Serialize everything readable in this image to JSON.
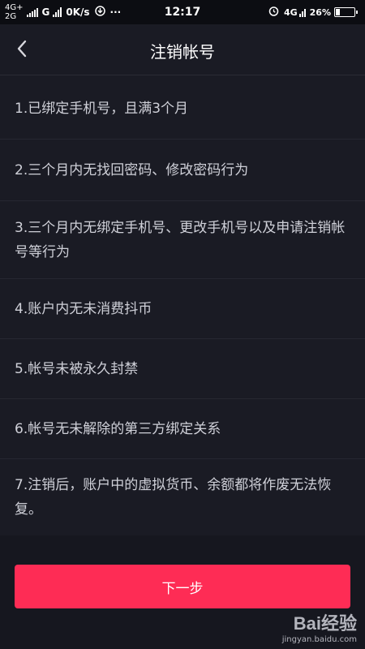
{
  "status_bar": {
    "net_top": "4G+",
    "net_bottom": "2G",
    "carrier_g": "G",
    "speed": "0K/s",
    "more": "···",
    "time": "12:17",
    "right_net": "4G",
    "battery": "26%",
    "battery_level": 0.26
  },
  "header": {
    "title": "注销帐号",
    "back_icon": "chevron-left-icon"
  },
  "conditions": [
    {
      "text": "1.已绑定手机号，且满3个月"
    },
    {
      "text": "2.三个月内无找回密码、修改密码行为"
    },
    {
      "text": "3.三个月内无绑定手机号、更改手机号以及申请注销帐号等行为"
    },
    {
      "text": "4.账户内无未消费抖币"
    },
    {
      "text": "5.帐号未被永久封禁"
    },
    {
      "text": "6.帐号无未解除的第三方绑定关系"
    },
    {
      "text": "7.注销后，账户中的虚拟货币、余额都将作废无法恢复。"
    }
  ],
  "footer": {
    "next_label": "下一步"
  },
  "watermark": {
    "logo": "Bai经验",
    "url": "jingyan.baidu.com"
  },
  "colors": {
    "accent": "#fe2c55",
    "background": "#1a1b24"
  }
}
